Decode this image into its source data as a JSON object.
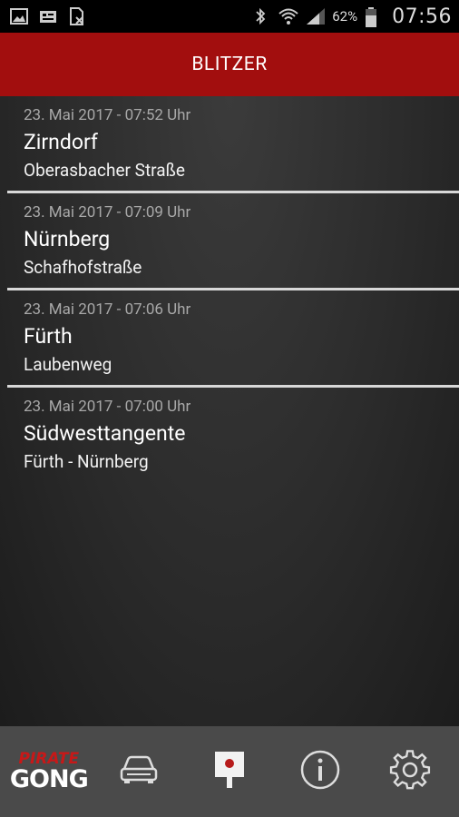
{
  "status_bar": {
    "battery_percent": "62%",
    "time": "07:56",
    "icons": [
      "image-icon",
      "sim-icon",
      "file-x-icon",
      "bluetooth-icon",
      "wifi-icon",
      "signal-icon",
      "battery-icon"
    ]
  },
  "app_bar": {
    "title": "BLITZER",
    "color": "#a20e0e"
  },
  "items": [
    {
      "date": "23. Mai 2017 - 07:52 Uhr",
      "city": "Zirndorf",
      "street": "Oberasbacher Straße"
    },
    {
      "date": "23. Mai 2017 - 07:09 Uhr",
      "city": "Nürnberg",
      "street": "Schafhofstraße"
    },
    {
      "date": "23. Mai 2017 - 07:06 Uhr",
      "city": "Fürth",
      "street": "Laubenweg"
    },
    {
      "date": "23. Mai 2017 - 07:00 Uhr",
      "city": "Südwesttangente",
      "street": "Fürth - Nürnberg"
    }
  ],
  "bottom_nav": {
    "logo_top": "PIRATE",
    "logo_bottom": "GONG",
    "icons": [
      "logo",
      "car-icon",
      "speed-camera-icon",
      "info-icon",
      "settings-icon"
    ]
  }
}
